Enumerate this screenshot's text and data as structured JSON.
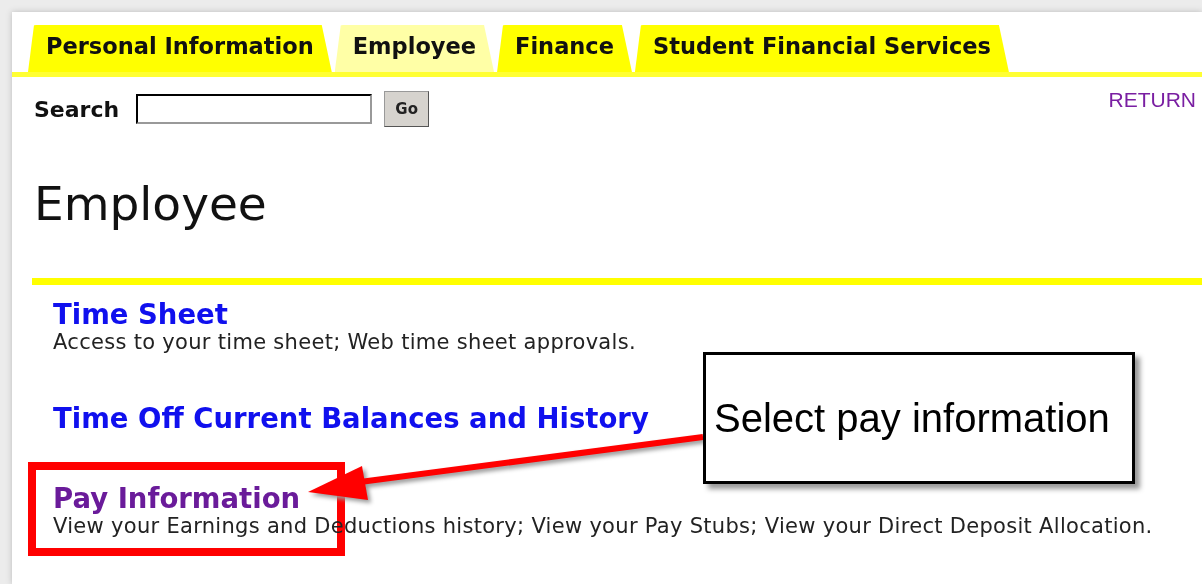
{
  "tabs": [
    {
      "label": "Personal Information",
      "selected": false
    },
    {
      "label": "Employee",
      "selected": true
    },
    {
      "label": "Finance",
      "selected": false
    },
    {
      "label": "Student Financial Services",
      "selected": false
    }
  ],
  "search": {
    "label": "Search",
    "button": "Go"
  },
  "return_link": "RETURN",
  "heading": "Employee",
  "menu": [
    {
      "title": "Time Sheet",
      "description": "Access to your time sheet; Web time sheet approvals.",
      "visited": false
    },
    {
      "title": "Time Off Current Balances and History",
      "visited": false
    },
    {
      "title": "Pay Information",
      "description": "View your Earnings and Deductions history; View your Pay Stubs; View your Direct Deposit Allocation.",
      "visited": true
    }
  ],
  "annotation": {
    "callout": "Select pay information"
  }
}
